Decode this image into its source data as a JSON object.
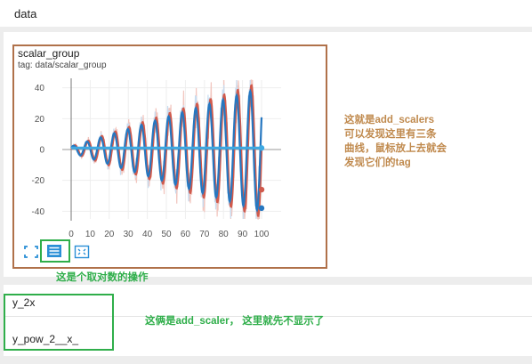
{
  "header": {
    "title": "data"
  },
  "card": {
    "title": "scalar_group",
    "tag": "tag: data/scalar_group"
  },
  "chart_data": {
    "type": "line",
    "x_ticks": [
      0,
      10,
      20,
      30,
      40,
      50,
      60,
      70,
      80,
      90,
      100
    ],
    "y_ticks": [
      40,
      20,
      0,
      -20,
      -40
    ],
    "xlim": [
      0,
      100
    ],
    "ylim": [
      -45,
      45
    ],
    "series": [
      {
        "color": "#d05a4c",
        "faint_color": "#f2c6bf",
        "amplitude_start": 2,
        "amplitude_end": 44,
        "cycles": 14,
        "phase": 0.0,
        "end_marker_value": -26
      },
      {
        "color": "#2677c0",
        "faint_color": "#c7dcf0",
        "amplitude_start": 2,
        "amplitude_end": 40,
        "cycles": 14,
        "phase": 0.55,
        "end_marker_value": -38
      },
      {
        "color": "#3ea9e2",
        "faint_color": "#3ea9e2",
        "amplitude_start": 0,
        "amplitude_end": 0,
        "cycles": 0,
        "phase": 0.0,
        "end_marker_value": 1
      }
    ]
  },
  "toolbar": {
    "expand_icon": "expand-icon",
    "log_icon": "log-scale-icon",
    "fit_icon": "fit-domain-icon"
  },
  "annotations": {
    "scalers_lines": [
      "这就是add_scalers",
      "可以发现这里有三条",
      "曲线，鼠标放上去就会",
      "发现它们的tag"
    ],
    "log_note": "这是个取对数的操作",
    "scalar_note": "这俩是add_scaler， 这里就先不显示了"
  },
  "runs": [
    {
      "name": "y_2x"
    },
    {
      "name": "y_pow_2__x_"
    }
  ],
  "colors": {
    "chart_box": "#b0714a",
    "highlight_green": "#2fae4a",
    "note_brown": "#c08a4e"
  }
}
